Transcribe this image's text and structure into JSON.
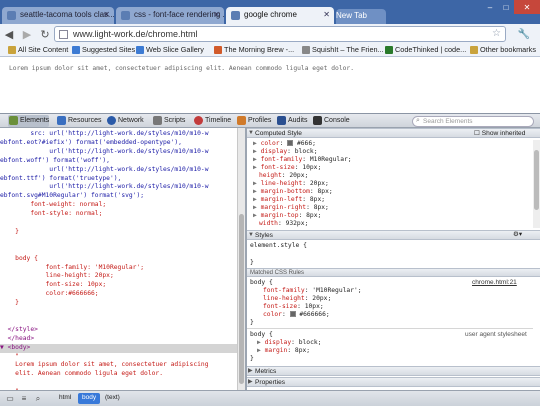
{
  "browser": {
    "tabs": [
      {
        "title": "seattle-tacoma tools clas...",
        "active": false
      },
      {
        "title": "css - font-face rendering ...",
        "active": false
      },
      {
        "title": "google chrome",
        "active": true
      }
    ],
    "new_tab_label": "New Tab",
    "url": "www.light-work.de/chrome.html",
    "bookmarks": [
      "All Site Content",
      "Suggested Sites",
      "Web Slice Gallery",
      "The Morning Brew -...",
      "SquishIt – The Frien...",
      "CodeThinked | code...",
      "Other bookmarks"
    ]
  },
  "page": {
    "text": "Lorem ipsum dolor sit amet, consectetuer adipiscing elit. Aenean commodo ligula eget dolor."
  },
  "devtools": {
    "tabs": [
      "Elements",
      "Resources",
      "Network",
      "Scripts",
      "Timeline",
      "Profiles",
      "Audits",
      "Console"
    ],
    "search_placeholder": "Search Elements",
    "elements_lines": [
      "        src: url('http://light-work.de/styles/m10/m10-w",
      "ebfont.eot?#iefix') format('embedded-opentype'),",
      "             url('http://light-work.de/styles/m10/m10-w",
      "ebfont.woff') format('woff'),",
      "             url('http://light-work.de/styles/m10/m10-w",
      "ebfont.ttf') format('truetype'),",
      "             url('http://light-work.de/styles/m10/m10-w",
      "ebfont.svg#M10Regular') format('svg');",
      "        font-weight: normal;",
      "        font-style: normal;",
      "",
      "    }",
      "",
      "",
      "    body {",
      "            font-family: 'M10Regular';",
      "            line-height: 20px;",
      "            font-size: 10px;",
      "            color:#666666;",
      "    }",
      "",
      "",
      "  </style>",
      "  </head>",
      "▼ <body>",
      "    \"",
      "    Lorem ipsum dolor sit amet, consectetuer adipiscing",
      "    elit. Aenean commodo ligula eget dolor.",
      "",
      "    \"",
      "  </body>",
      "</html>"
    ],
    "computed_style": {
      "header": "Computed Style",
      "show_inherited": "Show inherited",
      "lines": [
        {
          "prop": "color",
          "value": "#666;",
          "swatch": true
        },
        {
          "prop": "display",
          "value": "block;"
        },
        {
          "prop": "font-family",
          "value": "M10Regular;"
        },
        {
          "prop": "font-size",
          "value": "10px;"
        },
        {
          "prop": "height",
          "value": "20px;",
          "indent": true
        },
        {
          "prop": "line-height",
          "value": "20px;"
        },
        {
          "prop": "margin-bottom",
          "value": "8px;"
        },
        {
          "prop": "margin-left",
          "value": "8px;"
        },
        {
          "prop": "margin-right",
          "value": "8px;"
        },
        {
          "prop": "margin-top",
          "value": "8px;"
        },
        {
          "prop": "width",
          "value": "932px;",
          "indent": true
        }
      ]
    },
    "styles": {
      "header": "Styles",
      "element_style": "element.style {",
      "element_close": "}",
      "matched_header": "Matched CSS Rules",
      "rule1": {
        "selector": "body {",
        "source": "chrome.html:21",
        "lines": [
          "font-family: 'M10Regular';",
          "line-height: 20px;",
          "font-size: 10px;",
          "color:  #666666;"
        ],
        "close": "}"
      },
      "rule2": {
        "selector": "body {",
        "source": "user agent stylesheet",
        "lines": [
          "display: block;",
          "margin: 8px;"
        ],
        "close": "}"
      }
    },
    "metrics_header": "Metrics",
    "properties_header": "Properties",
    "breadcrumbs": [
      "html",
      "body",
      "(text)"
    ],
    "selected_crumb": "body"
  },
  "colors": {
    "tabstrip": "#3d66a6",
    "selected_crumb": "#3879d9",
    "swatch": "#666666"
  }
}
